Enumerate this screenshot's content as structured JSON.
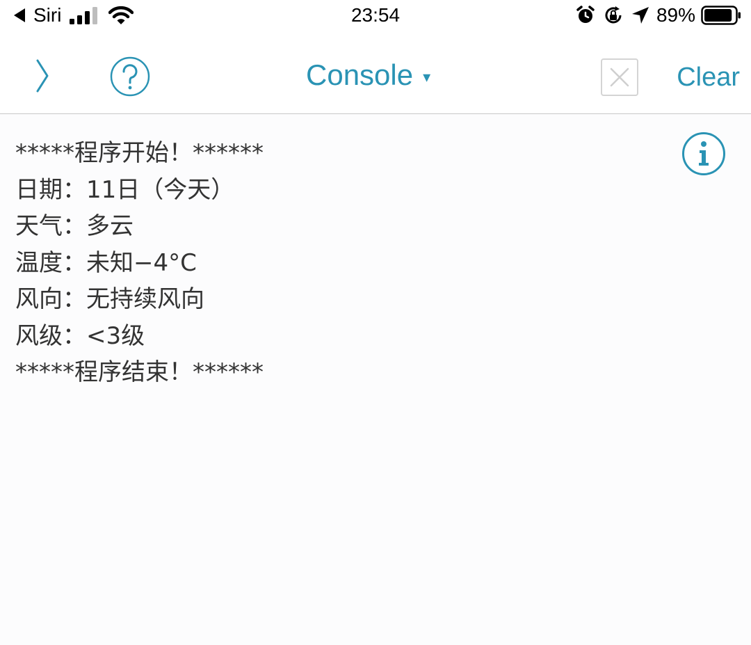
{
  "status_bar": {
    "back_app": "Siri",
    "time": "23:54",
    "battery_percent": "89%",
    "battery_level": 0.89,
    "signal_bars": 3,
    "icons": [
      "back-arrow-icon",
      "signal-icon",
      "wifi-icon",
      "alarm-icon",
      "orientation-lock-icon",
      "location-icon",
      "battery-icon"
    ]
  },
  "nav": {
    "title": "Console",
    "dropdown_caret": "▾",
    "clear_label": "Clear",
    "icons": [
      "chevron-right-icon",
      "help-icon",
      "close-icon",
      "info-icon"
    ],
    "accent_color": "#2a93b4"
  },
  "console": {
    "lines": [
      "*****程序开始！******",
      "日期：11日（今天）",
      "天气：多云",
      "温度：未知−4°C",
      "风向：无持续风向",
      "风级：<3级",
      "*****程序结束！******"
    ],
    "text_color": "#333333"
  }
}
